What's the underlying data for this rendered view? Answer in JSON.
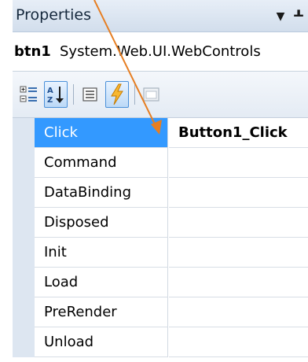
{
  "panel": {
    "title": "Properties",
    "dropdown_icon": "dropdown-arrow-icon",
    "pin_icon": "pin-icon"
  },
  "object_selector": {
    "name": "btn1",
    "type": "System.Web.UI.WebControls"
  },
  "toolbar": {
    "buttons": [
      {
        "icon": "categorized-icon",
        "active": false
      },
      {
        "icon": "alphabetical-sort-icon",
        "active": true
      },
      {
        "icon": "properties-icon",
        "active": false
      },
      {
        "icon": "events-lightning-icon",
        "active": true
      },
      {
        "icon": "property-pages-icon",
        "active": false
      }
    ]
  },
  "events": [
    {
      "name": "Click",
      "value": "Button1_Click",
      "selected": true
    },
    {
      "name": "Command",
      "value": ""
    },
    {
      "name": "DataBinding",
      "value": ""
    },
    {
      "name": "Disposed",
      "value": ""
    },
    {
      "name": "Init",
      "value": ""
    },
    {
      "name": "Load",
      "value": ""
    },
    {
      "name": "PreRender",
      "value": ""
    },
    {
      "name": "Unload",
      "value": ""
    }
  ],
  "colors": {
    "selection": "#3399ff",
    "annotation_arrow": "#e67e22",
    "gutter": "#dde6f1"
  }
}
